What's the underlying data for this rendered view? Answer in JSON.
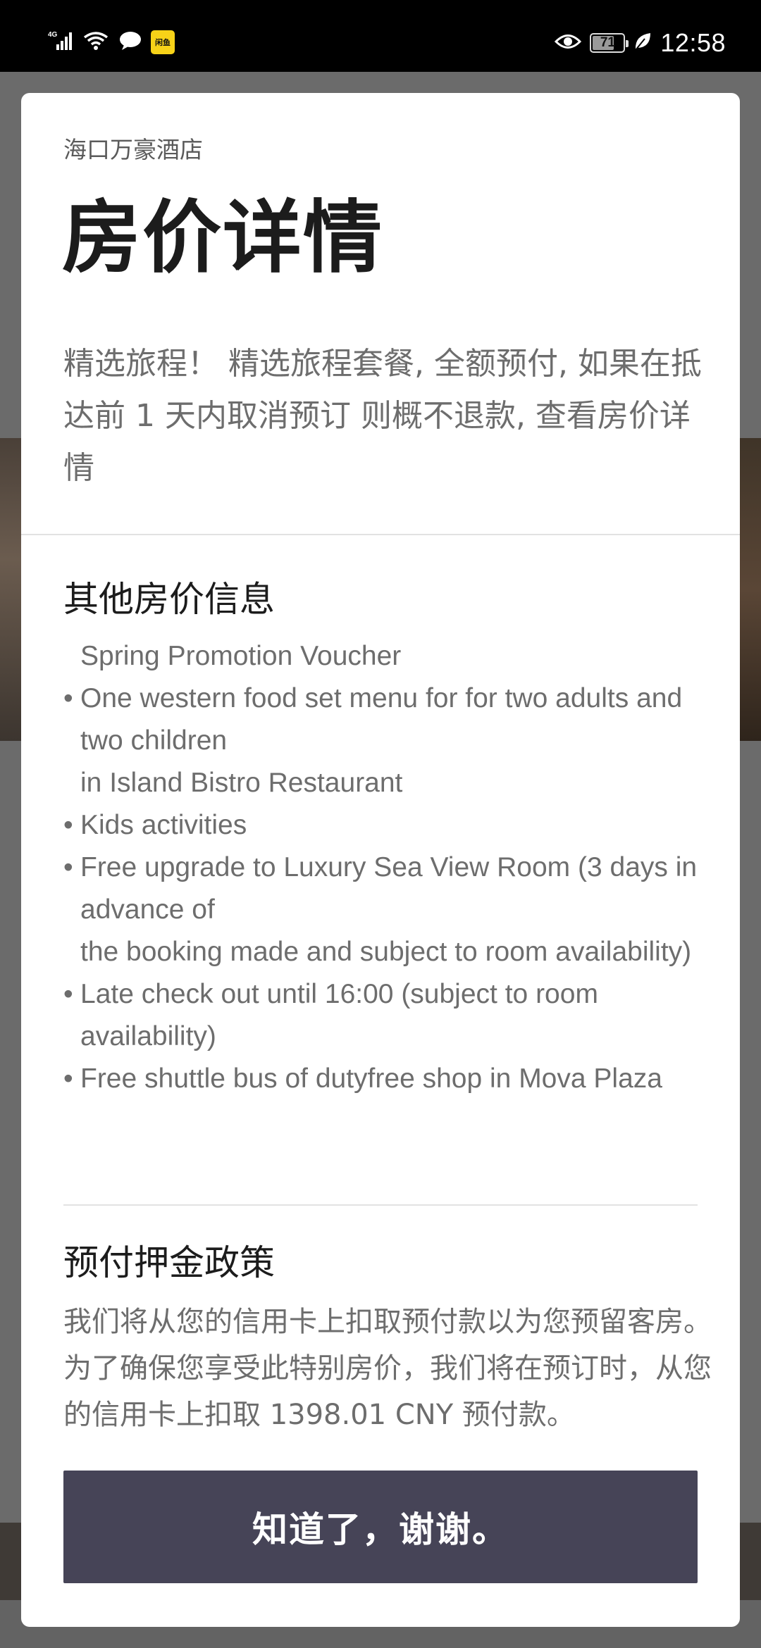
{
  "status_bar": {
    "network_label": "4G",
    "app_badge_label": "闲鱼",
    "battery_level": 71,
    "battery_text": "71",
    "time": "12:58",
    "icons": [
      "signal-icon",
      "wifi-icon",
      "message-bubble-icon",
      "app-badge-icon",
      "eye-icon",
      "battery-icon",
      "leaf-icon"
    ]
  },
  "modal": {
    "hotel_name": "海口万豪酒店",
    "title": "房价详情",
    "description": "精选旅程！ 精选旅程套餐, 全额预付, 如果在抵达前 1 天内取消预订 则概不退款, 查看房价详情",
    "other_info": {
      "heading": "其他房价信息",
      "items": [
        {
          "bullet": "",
          "lines": [
            "Spring Promotion Voucher"
          ]
        },
        {
          "bullet": "•",
          "lines": [
            "One western food set menu for for two adults and two children",
            "in Island Bistro Restaurant"
          ]
        },
        {
          "bullet": "•",
          "lines": [
            "Kids activities"
          ]
        },
        {
          "bullet": "•",
          "lines": [
            "Free upgrade to Luxury Sea View Room (3 days in advance of",
            "the booking made and subject to room availability)"
          ]
        },
        {
          "bullet": "•",
          "lines": [
            "Late check out until 16:00 (subject to room availability)"
          ]
        },
        {
          "bullet": "•",
          "lines": [
            "Free shuttle bus of dutyfree shop in Mova Plaza"
          ]
        }
      ]
    },
    "deposit_policy": {
      "heading": "预付押金政策",
      "text": "我们将从您的信用卡上扣取预付款以为您预留客房。为了确保您享受此特别房价，我们将在预订时，从您的信用卡上扣取 1398.01 CNY 预付款。"
    },
    "ok_button_label": "知道了，谢谢。",
    "colors": {
      "button_bg": "#464457",
      "title": "#1c1c1c",
      "body_text": "#6d6d6d"
    }
  }
}
